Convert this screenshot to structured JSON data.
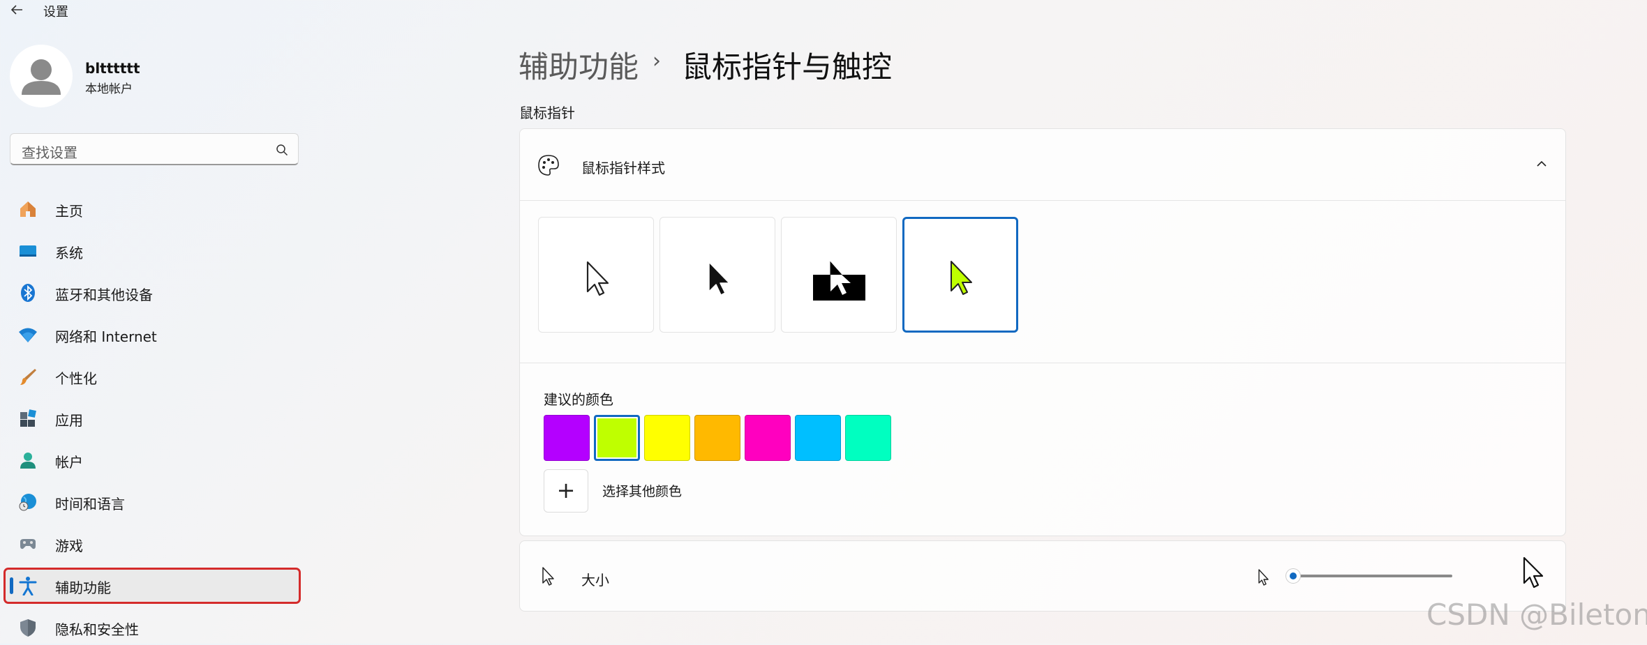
{
  "window": {
    "title": "设置",
    "back_icon": "back-arrow-icon"
  },
  "user": {
    "name": "bltttttt",
    "account_type": "本地帐户"
  },
  "search": {
    "placeholder": "查找设置",
    "icon": "search-icon"
  },
  "sidebar": {
    "items": [
      {
        "label": "主页",
        "icon": "home-icon"
      },
      {
        "label": "系统",
        "icon": "system-icon"
      },
      {
        "label": "蓝牙和其他设备",
        "icon": "bluetooth-icon"
      },
      {
        "label": "网络和 Internet",
        "icon": "wifi-icon"
      },
      {
        "label": "个性化",
        "icon": "brush-icon"
      },
      {
        "label": "应用",
        "icon": "apps-icon"
      },
      {
        "label": "帐户",
        "icon": "account-icon"
      },
      {
        "label": "时间和语言",
        "icon": "globe-clock-icon"
      },
      {
        "label": "游戏",
        "icon": "gamepad-icon"
      },
      {
        "label": "辅助功能",
        "icon": "accessibility-icon",
        "active": true
      },
      {
        "label": "隐私和安全性",
        "icon": "shield-icon"
      }
    ]
  },
  "main": {
    "breadcrumb_parent": "辅助功能",
    "breadcrumb_separator": "›",
    "breadcrumb_current": "鼠标指针与触控",
    "section_label": "鼠标指针",
    "pointer_style": {
      "title": "鼠标指针样式",
      "expanded": true,
      "styles": [
        "white",
        "black",
        "inverted",
        "custom"
      ],
      "selected_style": "custom",
      "suggested_colors_label": "建议的颜色",
      "suggested_colors": [
        "#b400ff",
        "#bfff00",
        "#ffff00",
        "#ffb900",
        "#ff00bf",
        "#00bfff",
        "#00ffc0"
      ],
      "selected_color": "#bfff00",
      "choose_other_color_label": "选择其他颜色",
      "add_icon": "plus-icon"
    },
    "size": {
      "label": "大小",
      "slider_value": 1,
      "slider_min": 1,
      "slider_max": 15
    }
  },
  "colors": {
    "accent": "#1169c1",
    "highlight_outline": "#d42b2b"
  },
  "watermark": "CSDN @Bileton"
}
